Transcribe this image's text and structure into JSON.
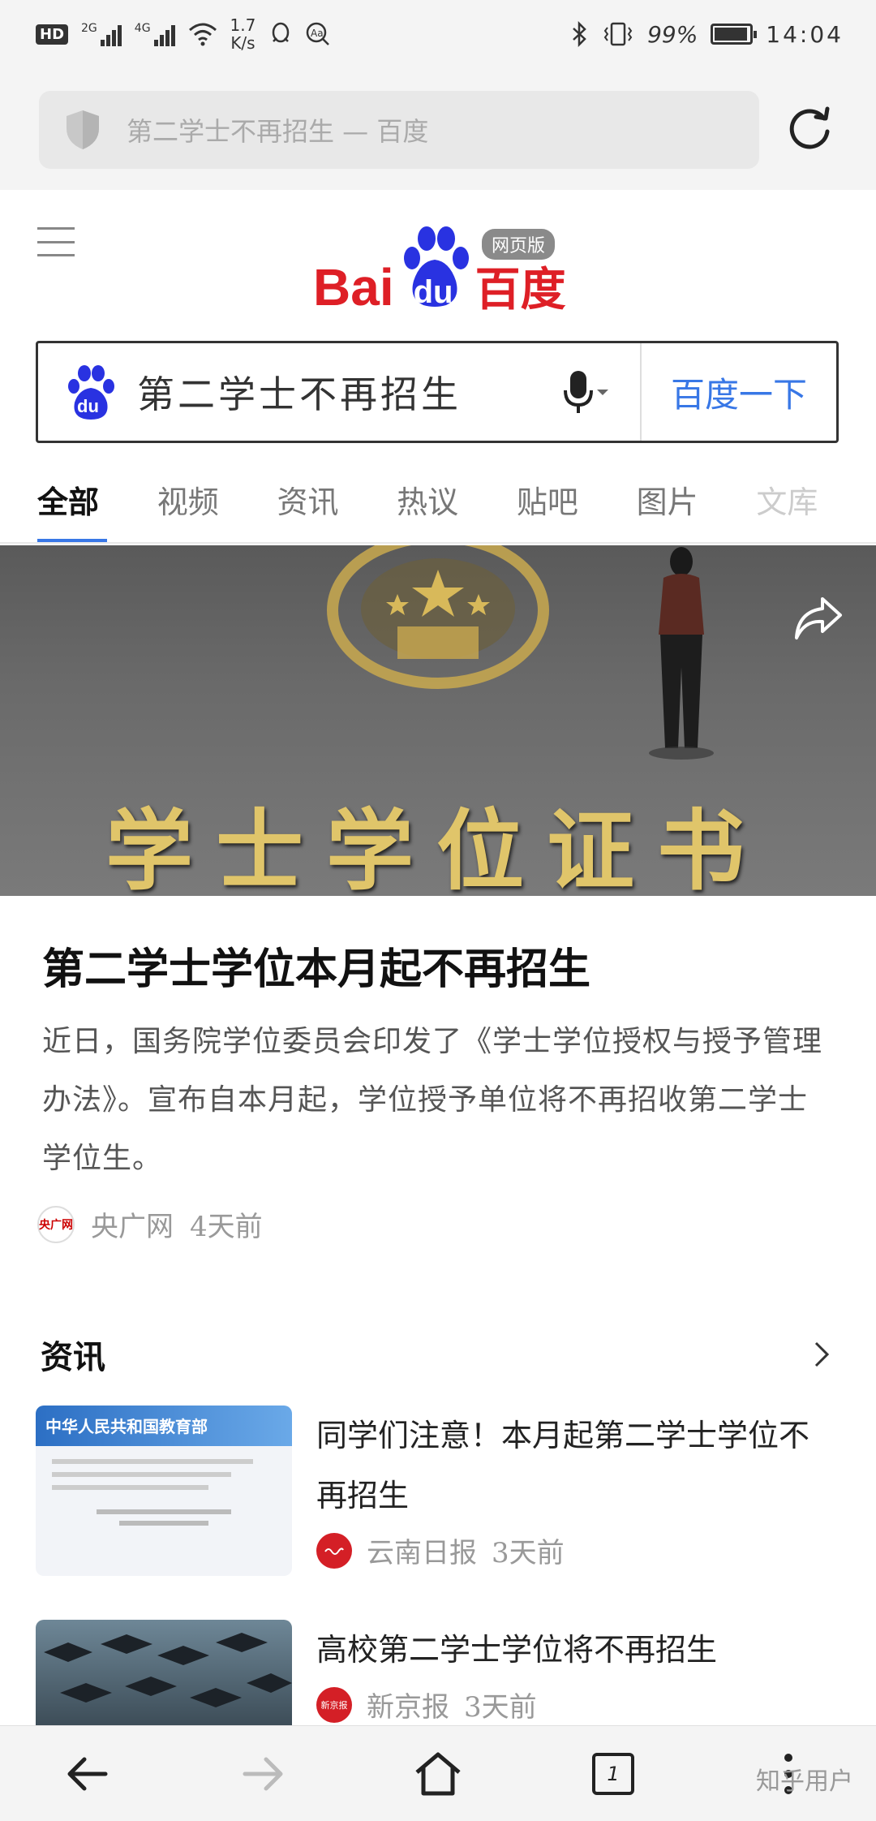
{
  "status_bar": {
    "badge": "HD",
    "net1": "2G",
    "net2": "4G",
    "speed_value": "1.7",
    "speed_unit": "K/s",
    "battery": "99%",
    "time": "14:04"
  },
  "address_bar": {
    "text": "第二学士不再招生 — 百度"
  },
  "header": {
    "logo_bai": "Bai",
    "logo_du": "du",
    "logo_hanzi": "百度",
    "logo_tag": "网页版"
  },
  "search": {
    "query": "第二学士不再招生",
    "button_label": "百度一下"
  },
  "tabs": [
    "全部",
    "视频",
    "资讯",
    "热议",
    "贴吧",
    "图片",
    "文库"
  ],
  "hero": {
    "image_text": "学士学位证书"
  },
  "article": {
    "title": "第二学士学位本月起不再招生",
    "summary": "近日，国务院学位委员会印发了《学士学位授权与授予管理办法》。宣布自本月起，学位授予单位将不再招收第二学士学位生。",
    "source_logo": "央广网",
    "source": "央广网",
    "time": "4天前"
  },
  "news": {
    "section_title": "资讯",
    "items": [
      {
        "headline": "同学们注意！本月起第二学士学位不再招生",
        "source": "云南日报",
        "time": "3天前",
        "thumb_caption": "中华人民共和国教育部"
      },
      {
        "headline": "高校第二学士学位将不再招生",
        "source": "新京报",
        "logo": "新京报",
        "time": "3天前"
      }
    ]
  },
  "bottom_nav": {
    "tab_count": "1"
  },
  "watermark": "知乎用户",
  "colors": {
    "brand_red": "#de1f26",
    "link_blue": "#3877e6",
    "paw_blue": "#2932e1"
  }
}
